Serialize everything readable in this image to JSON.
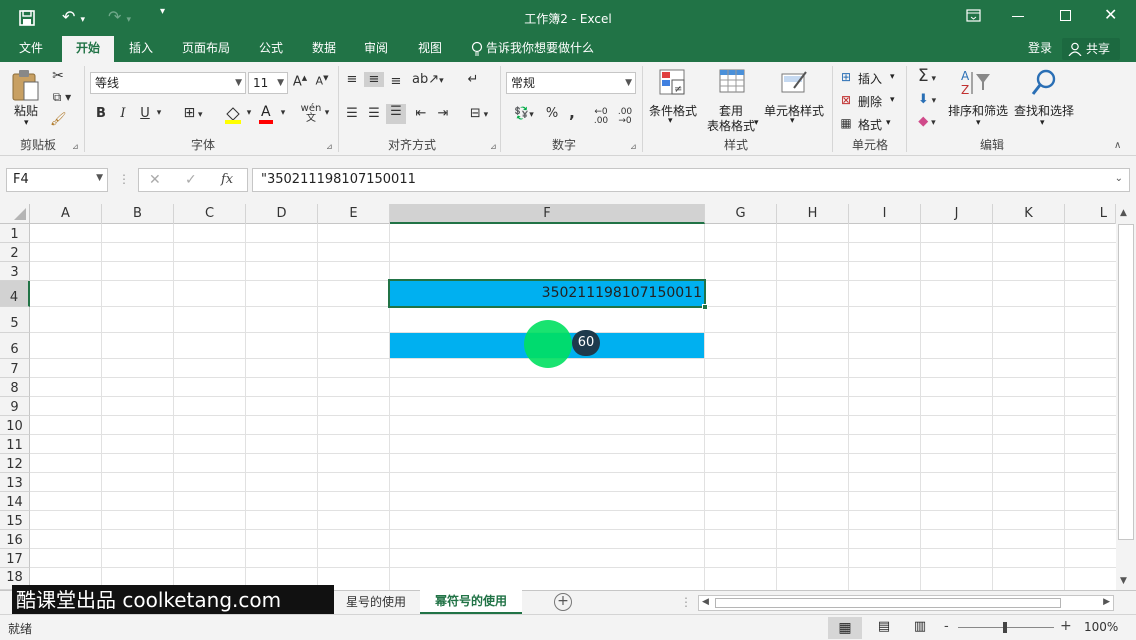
{
  "titlebar": {
    "title": "工作簿2 - Excel",
    "bg_color": "#217346"
  },
  "tabs": [
    {
      "label": "文件"
    },
    {
      "label": "开始",
      "active": true
    },
    {
      "label": "插入"
    },
    {
      "label": "页面布局"
    },
    {
      "label": "公式"
    },
    {
      "label": "数据"
    },
    {
      "label": "审阅"
    },
    {
      "label": "视图"
    }
  ],
  "tell_me": "告诉我你想要做什么",
  "login": "登录",
  "share": "共享",
  "ribbon": {
    "clipboard": {
      "paste": "粘贴",
      "group": "剪贴板"
    },
    "font": {
      "name": "等线",
      "size": "11",
      "group": "字体",
      "bold": "B",
      "italic": "I",
      "underline": "U"
    },
    "alignment": {
      "group": "对齐方式"
    },
    "number": {
      "format": "常规",
      "group": "数字",
      "percent": "%",
      "comma": ","
    },
    "styles": {
      "conditional": "条件格式",
      "table_line1": "套用",
      "table_line2": "表格格式",
      "cell_styles": "单元格样式",
      "group": "样式"
    },
    "cells": {
      "insert": "插入",
      "delete": "删除",
      "format": "格式",
      "group": "单元格"
    },
    "editing": {
      "sort": "排序和筛选",
      "find": "查找和选择",
      "group": "编辑"
    }
  },
  "formula_bar": {
    "name_box": "F4",
    "formula": "\"350211198107150011",
    "fx": "fx"
  },
  "columns": [
    "A",
    "B",
    "C",
    "D",
    "E",
    "F",
    "G",
    "H",
    "I",
    "J",
    "K",
    "L"
  ],
  "rows": [
    "1",
    "2",
    "3",
    "4",
    "5",
    "6",
    "7",
    "8",
    "9",
    "10",
    "11",
    "12",
    "13",
    "14",
    "15",
    "16",
    "17",
    "18"
  ],
  "cells": {
    "F4": "350211198107150011"
  },
  "highlight_color": "#00b0f0",
  "click_marker": {
    "label": "60",
    "color": "#00e060"
  },
  "sheets": [
    {
      "label": "星号的使用",
      "active": false
    },
    {
      "label": "幂符号的使用",
      "active": true
    }
  ],
  "watermark": "酷课堂出品 coolketang.com",
  "status": {
    "ready": "就绪",
    "zoom": "100%",
    "minus": "-",
    "plus": "+"
  }
}
